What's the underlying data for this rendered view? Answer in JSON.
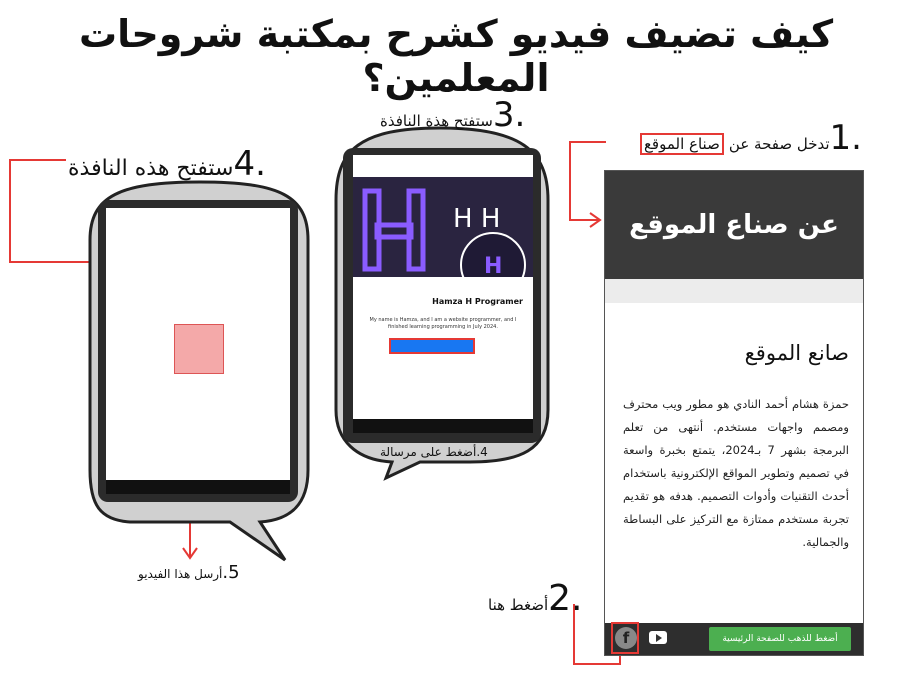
{
  "title": "كيف تضيف فيديو كشرح بمكتبة شروحات المعلمين؟",
  "steps": {
    "s1_num": "1.",
    "s1_text": "تدخل صفحة عن",
    "s1_highlight": "صناع الموقع",
    "s2_num": "2.",
    "s2_text": "أضغط هنا",
    "s3_num": "3.",
    "s3_text": "ستفتح هذة النافذة",
    "s4a_num": "4.",
    "s4a_text": "ستفتح هذه النافذة",
    "s4b_num": "4.",
    "s4b_text": "أضغط على مرسالة",
    "s5_num": "5.",
    "s5_text": "أرسل هذا الفيديو"
  },
  "site": {
    "hero_title": "عن صناع الموقع",
    "heading": "صانع الموقع",
    "paragraph": "حمزة هشام أحمد النادي هو مطور ويب محترف ومصمم واجهات مستخدم. أنتهى من تعلم البرمجة بشهر 7 بـ2024، يتمتع بخبرة واسعة في تصميم وتطوير المواقع الإلكترونية باستخدام أحدث التقنيات وأدوات التصميم. هدفه هو تقديم تجربة مستخدم ممتازة مع التركيز على البساطة والجمالية.",
    "home_button": "أضغط للذهب للصفحة الرئيسية",
    "fb_icon_glyph": "f"
  },
  "phone3": {
    "name": "Hamza H Programer",
    "bio": "My name is Hamza, and I am a website programmer, and I finished learning programming in July 2024."
  },
  "colors": {
    "highlight_red": "#e53935",
    "hero_bg": "#3a3a3a",
    "button_green": "#4caf50",
    "messenger_blue": "#1877f2"
  }
}
